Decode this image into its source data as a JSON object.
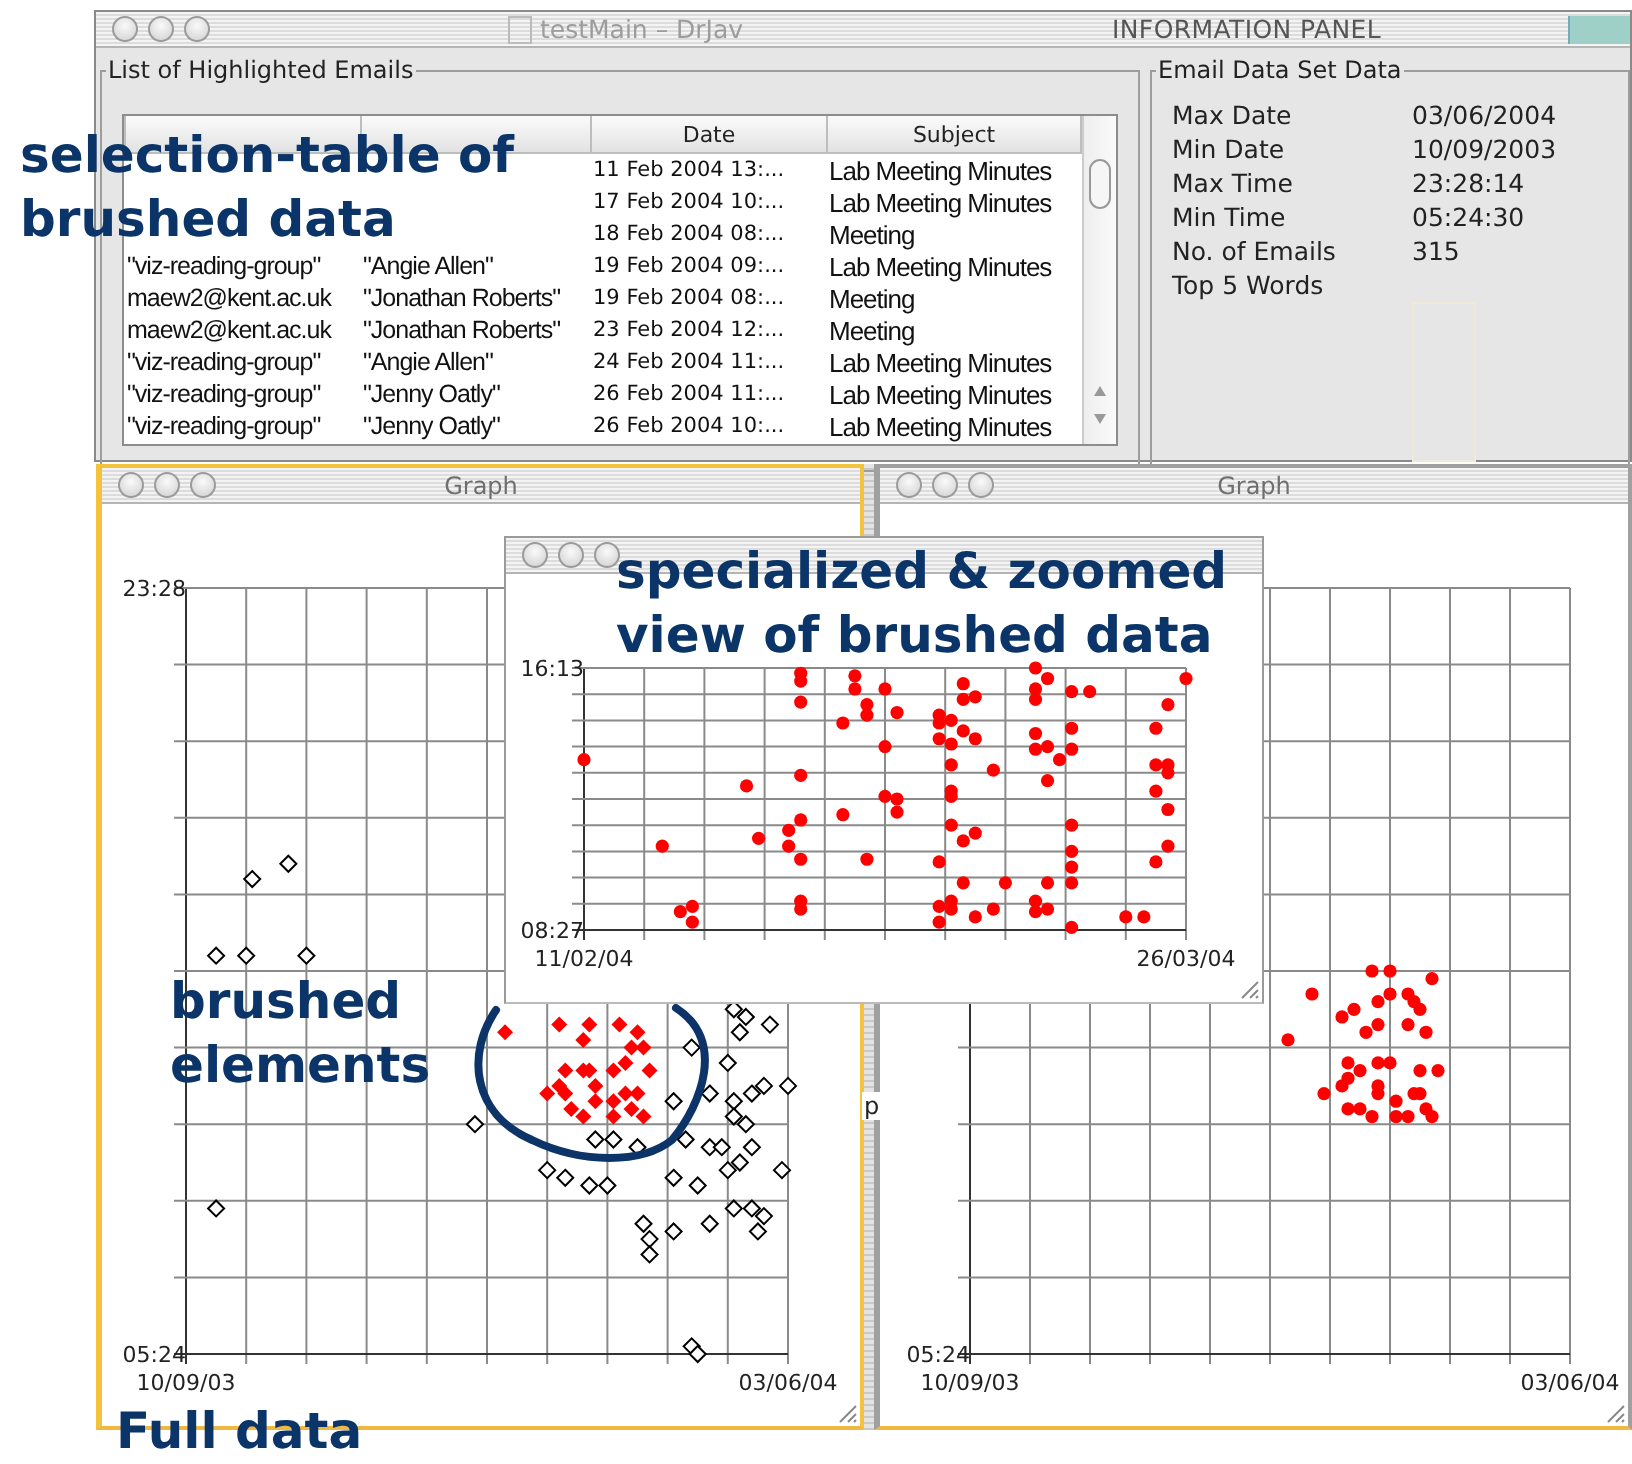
{
  "information_panel": {
    "title": "INFORMATION PANEL",
    "ghost_title": "testMain – DrJav",
    "emails": {
      "title": "List of Highlighted Emails",
      "columns": [
        null,
        null,
        "Date",
        "Subject"
      ],
      "rows": [
        {
          "cells": [
            null,
            null,
            "11 Feb 2004 13:...",
            "Lab Meeting Minutes"
          ]
        },
        {
          "cells": [
            null,
            null,
            "17 Feb 2004 10:...",
            "Lab Meeting Minutes"
          ]
        },
        {
          "cells": [
            null,
            null,
            "18 Feb 2004 08:...",
            "Meeting"
          ]
        },
        {
          "cells": [
            "\"viz-reading-group\"",
            "\"Angie Allen\"",
            "19 Feb 2004 09:...",
            "Lab Meeting Minutes"
          ]
        },
        {
          "cells": [
            "maew2@kent.ac.uk",
            "\"Jonathan Roberts\"",
            "19 Feb 2004 08:...",
            "Meeting"
          ]
        },
        {
          "cells": [
            "maew2@kent.ac.uk",
            "\"Jonathan Roberts\"",
            "23 Feb 2004 12:...",
            "Meeting"
          ]
        },
        {
          "cells": [
            "\"viz-reading-group\"",
            "\"Angie Allen\"",
            "24 Feb 2004 11:...",
            "Lab Meeting Minutes"
          ]
        },
        {
          "cells": [
            "\"viz-reading-group\"",
            "\"Jenny Oatly\"",
            "26 Feb 2004 11:...",
            "Lab Meeting Minutes"
          ]
        },
        {
          "cells": [
            "\"viz-reading-group\"",
            "\"Jenny Oatly\"",
            "26 Feb 2004 10:...",
            "Lab Meeting Minutes"
          ]
        }
      ]
    },
    "dataset": {
      "title": "Email Data Set Data",
      "fields": [
        {
          "label": "Max Date",
          "value": "03/06/2004"
        },
        {
          "label": "Min Date",
          "value": "10/09/2003"
        },
        {
          "label": "Max Time",
          "value": "23:28:14"
        },
        {
          "label": "Min Time",
          "value": "05:24:30"
        },
        {
          "label": "No. of Emails",
          "value": "315"
        },
        {
          "label": "Top 5 Words"
        }
      ]
    }
  },
  "graphs": [
    {
      "title": "Graph",
      "focused": true,
      "axis_labels": {
        "y_max": "23:28",
        "y_min": "05:24",
        "x_min": "10/09/03",
        "x_max": "03/06/04"
      }
    },
    {
      "title": "Graph",
      "focused": false,
      "axis_labels": {
        "y_min": "05:24",
        "x_min": "10/09/03",
        "x_max": "03/06/04"
      }
    },
    {
      "axis_labels": {
        "y_max": "16:13",
        "y_min": "08:27",
        "x_min": "11/02/04",
        "x_max": "26/03/04"
      }
    }
  ],
  "background_window": {
    "text": "p"
  },
  "annotations": [
    {
      "text": "selection-table of\nbrushed data"
    },
    {
      "text": "specialized & zoomed\nview of brushed data"
    },
    {
      "text": "brushed\nelements"
    },
    {
      "text": "Full data"
    }
  ]
}
